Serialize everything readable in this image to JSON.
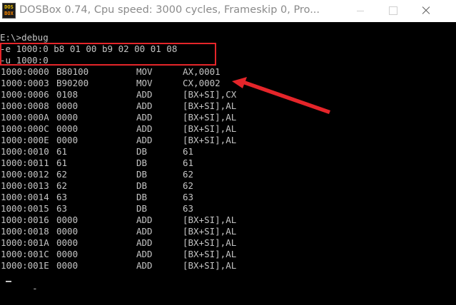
{
  "titlebar": {
    "title": "DOSBox 0.74, Cpu speed:     3000 cycles, Frameskip  0, Pro...",
    "icon_line1": "DOS",
    "icon_line2": "BOX"
  },
  "terminal": {
    "prompt_line": "E:\\>debug",
    "commands": [
      "-e 1000:0 b8 01 00 b9 02 00 01 08",
      "-u 1000:0"
    ],
    "disassembly": [
      {
        "addr": "1000:0000",
        "hex": "B80100",
        "mnemonic": "MOV",
        "operands": "AX,0001"
      },
      {
        "addr": "1000:0003",
        "hex": "B90200",
        "mnemonic": "MOV",
        "operands": "CX,0002"
      },
      {
        "addr": "1000:0006",
        "hex": "0108",
        "mnemonic": "ADD",
        "operands": "[BX+SI],CX"
      },
      {
        "addr": "1000:0008",
        "hex": "0000",
        "mnemonic": "ADD",
        "operands": "[BX+SI],AL"
      },
      {
        "addr": "1000:000A",
        "hex": "0000",
        "mnemonic": "ADD",
        "operands": "[BX+SI],AL"
      },
      {
        "addr": "1000:000C",
        "hex": "0000",
        "mnemonic": "ADD",
        "operands": "[BX+SI],AL"
      },
      {
        "addr": "1000:000E",
        "hex": "0000",
        "mnemonic": "ADD",
        "operands": "[BX+SI],AL"
      },
      {
        "addr": "1000:0010",
        "hex": "61",
        "mnemonic": "DB",
        "operands": "61"
      },
      {
        "addr": "1000:0011",
        "hex": "61",
        "mnemonic": "DB",
        "operands": "61"
      },
      {
        "addr": "1000:0012",
        "hex": "62",
        "mnemonic": "DB",
        "operands": "62"
      },
      {
        "addr": "1000:0013",
        "hex": "62",
        "mnemonic": "DB",
        "operands": "62"
      },
      {
        "addr": "1000:0014",
        "hex": "63",
        "mnemonic": "DB",
        "operands": "63"
      },
      {
        "addr": "1000:0015",
        "hex": "63",
        "mnemonic": "DB",
        "operands": "63"
      },
      {
        "addr": "1000:0016",
        "hex": "0000",
        "mnemonic": "ADD",
        "operands": "[BX+SI],AL"
      },
      {
        "addr": "1000:0018",
        "hex": "0000",
        "mnemonic": "ADD",
        "operands": "[BX+SI],AL"
      },
      {
        "addr": "1000:001A",
        "hex": "0000",
        "mnemonic": "ADD",
        "operands": "[BX+SI],AL"
      },
      {
        "addr": "1000:001C",
        "hex": "0000",
        "mnemonic": "ADD",
        "operands": "[BX+SI],AL"
      },
      {
        "addr": "1000:001E",
        "hex": "0000",
        "mnemonic": "ADD",
        "operands": "[BX+SI],AL"
      }
    ],
    "final_prompt": "-"
  },
  "colors": {
    "terminal_text": "#c4c4c4",
    "terminal_bg": "#000000",
    "annotation_red": "#e5252a",
    "titlebar_bg": "#ffffff"
  }
}
